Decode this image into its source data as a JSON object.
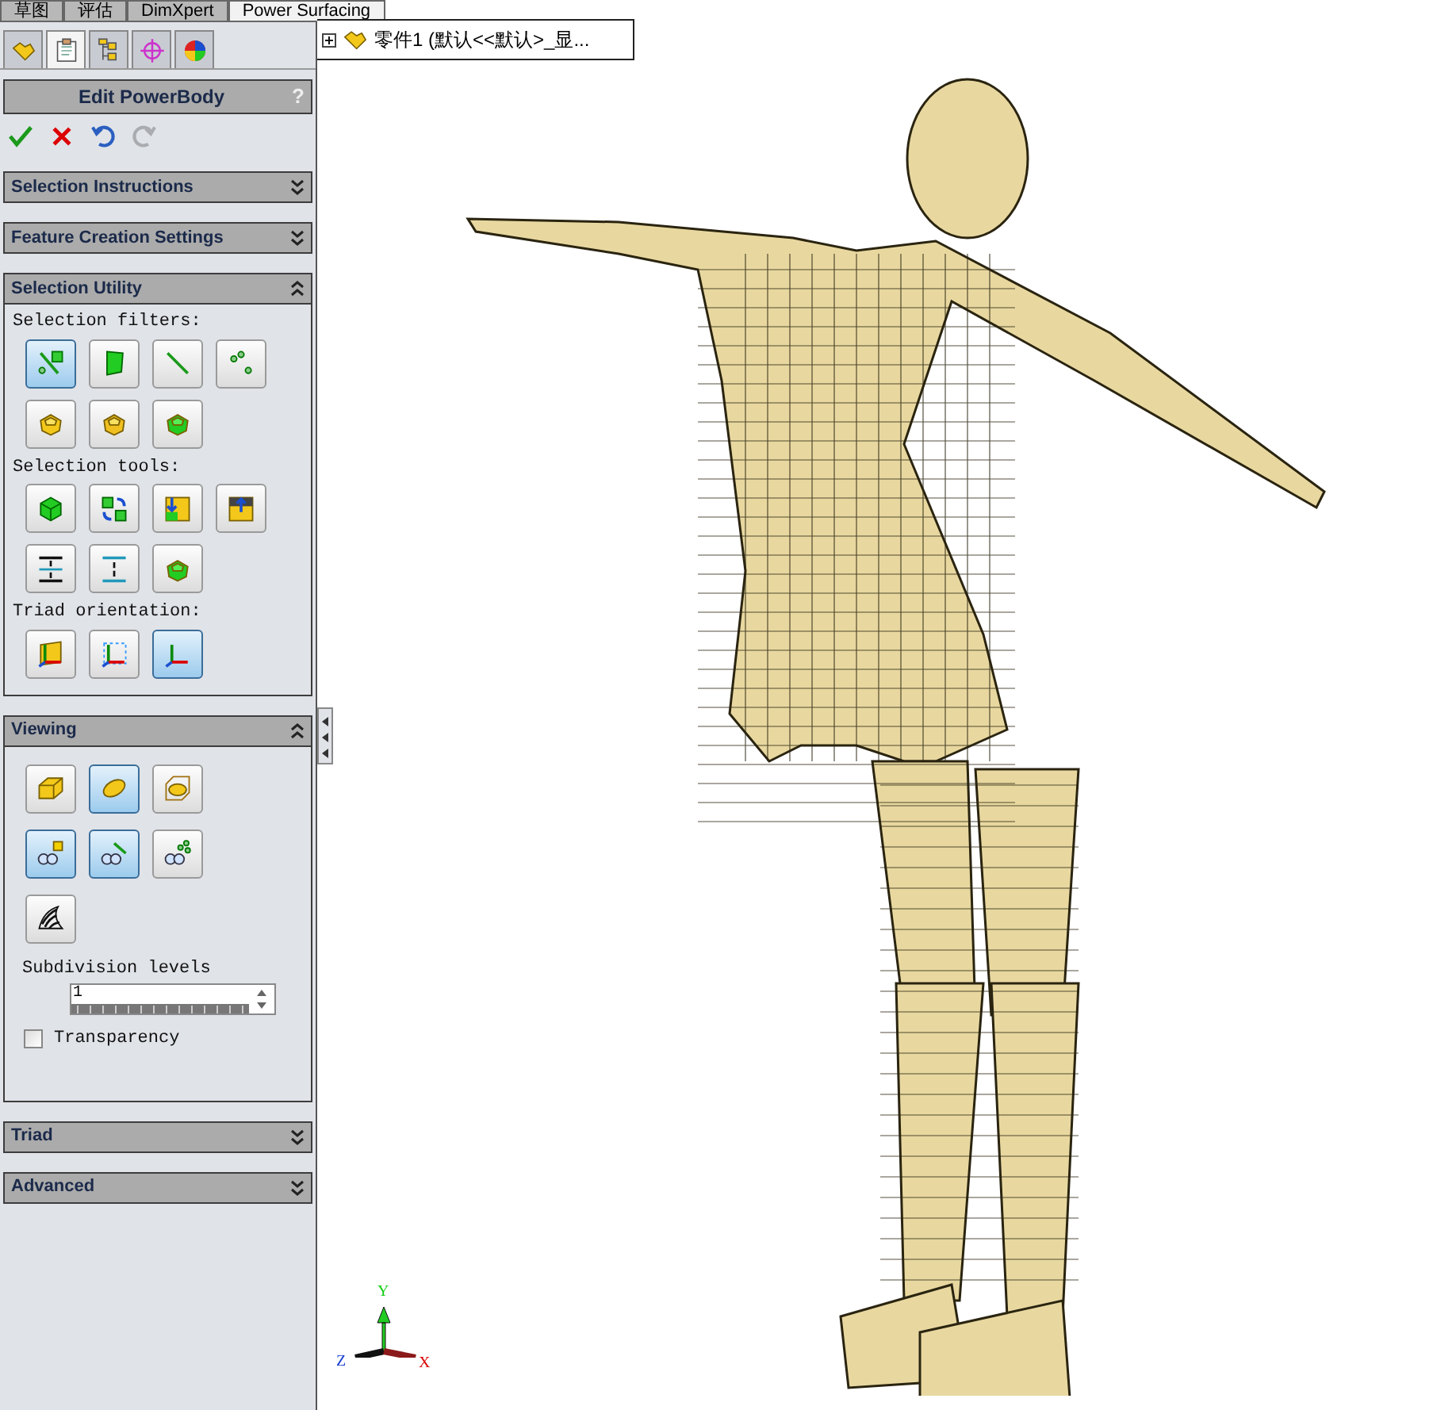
{
  "top_tabs": [
    {
      "label": "草图",
      "selected": false
    },
    {
      "label": "评估",
      "selected": false
    },
    {
      "label": "DimXpert",
      "selected": false
    },
    {
      "label": "Power Surfacing",
      "selected": true
    }
  ],
  "panel_tabs": [
    {
      "kind": "part",
      "selected": false
    },
    {
      "kind": "property",
      "selected": true
    },
    {
      "kind": "config",
      "selected": false
    },
    {
      "kind": "target",
      "selected": false
    },
    {
      "kind": "appearance",
      "selected": false
    }
  ],
  "tree": {
    "expanded": false,
    "label": "零件1  (默认<<默认>_显..."
  },
  "property_manager": {
    "title": "Edit PowerBody",
    "help": "?",
    "actions": [
      {
        "kind": "ok",
        "disabled": false
      },
      {
        "kind": "cancel",
        "disabled": false
      },
      {
        "kind": "undo",
        "disabled": false
      },
      {
        "kind": "redo",
        "disabled": true
      }
    ],
    "sections": [
      {
        "title": "Selection Instructions",
        "expanded": false
      },
      {
        "title": "Feature Creation Settings",
        "expanded": false
      },
      {
        "title": "Selection Utility",
        "expanded": true,
        "groups": [
          {
            "label": "Selection filters:",
            "rows": [
              [
                {
                  "kind": "edge_face",
                  "selected": true
                },
                {
                  "kind": "face",
                  "selected": false
                },
                {
                  "kind": "edge",
                  "selected": false
                },
                {
                  "kind": "vertex",
                  "selected": false
                }
              ],
              [
                {
                  "kind": "loop_yellow",
                  "selected": false
                },
                {
                  "kind": "loop_mixed",
                  "selected": false
                },
                {
                  "kind": "loop_green",
                  "selected": false
                }
              ]
            ]
          },
          {
            "label": "Selection tools:",
            "rows": [
              [
                {
                  "kind": "cube",
                  "selected": false
                },
                {
                  "kind": "swap_grid",
                  "selected": false
                },
                {
                  "kind": "grid_down",
                  "selected": false
                },
                {
                  "kind": "grid_up",
                  "selected": false
                }
              ],
              [
                {
                  "kind": "expand_lines",
                  "selected": false
                },
                {
                  "kind": "shrink_lines",
                  "selected": false
                },
                {
                  "kind": "loop_green",
                  "selected": false
                }
              ]
            ]
          },
          {
            "label": "Triad orientation:",
            "rows": [
              [
                {
                  "kind": "triad_plane",
                  "selected": false
                },
                {
                  "kind": "triad_box",
                  "selected": false
                },
                {
                  "kind": "triad_axes",
                  "selected": true
                }
              ]
            ]
          }
        ]
      },
      {
        "title": "Viewing",
        "expanded": true,
        "groups": [
          {
            "rows": [
              [
                {
                  "kind": "box",
                  "selected": false
                },
                {
                  "kind": "ellipsoid",
                  "selected": true
                },
                {
                  "kind": "cage",
                  "selected": false
                }
              ],
              [
                {
                  "kind": "glasses_face",
                  "selected": true
                },
                {
                  "kind": "glasses_edge",
                  "selected": true
                },
                {
                  "kind": "glasses_vertex",
                  "selected": false
                }
              ],
              [
                {
                  "kind": "zebra",
                  "selected": false
                }
              ]
            ]
          }
        ],
        "subdivision": {
          "label": "Subdivision levels",
          "value": "1"
        },
        "transparency": {
          "label": "Transparency",
          "checked": false
        }
      },
      {
        "title": "Triad",
        "expanded": false
      },
      {
        "title": "Advanced",
        "expanded": false
      }
    ]
  },
  "triad": {
    "y": "Y",
    "z": "Z",
    "x": "X"
  }
}
